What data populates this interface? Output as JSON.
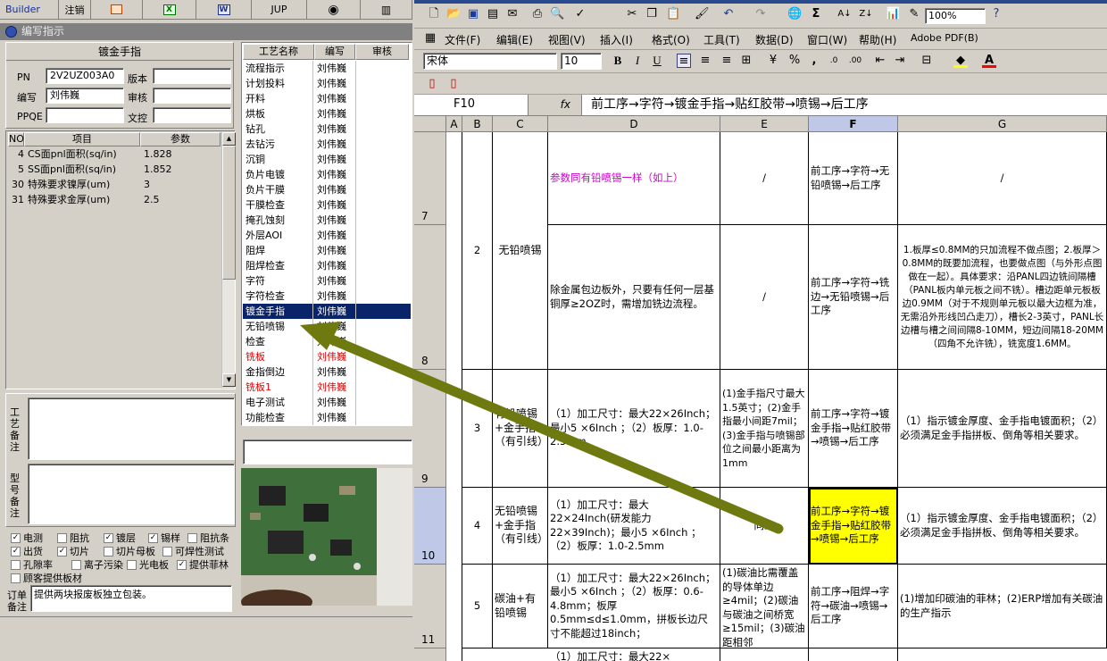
{
  "left_app": {
    "topbar": {
      "builder": "Builder",
      "logout": "注销",
      "jup": "JUP"
    },
    "dialog_title": "编写指示",
    "form": {
      "header": "镀金手指",
      "pn_label": "PN",
      "pn_value": "2V2UZ003A0",
      "version_label": "版本",
      "version_value": "",
      "writer_label": "编写",
      "writer_value": "刘伟巍",
      "review_label": "审核",
      "review_value": "",
      "ppqe_label": "PPQE",
      "ppqe_value": "",
      "doc_control_label": "文控",
      "doc_control_value": ""
    },
    "param_table": {
      "headers": [
        "NO",
        "项目",
        "参数"
      ],
      "rows": [
        {
          "no": "4",
          "item": "CS面pnl面积(sq/in)",
          "value": "1.828"
        },
        {
          "no": "5",
          "item": "SS面pnl面积(sq/in)",
          "value": "1.852"
        },
        {
          "no": "30",
          "item": "特殊要求镍厚(um)",
          "value": "3"
        },
        {
          "no": "31",
          "item": "特殊要求金厚(um)",
          "value": "2.5"
        }
      ]
    },
    "process_table": {
      "headers": [
        "工艺名称",
        "编写",
        "审核"
      ],
      "rows": [
        {
          "name": "流程指示",
          "writer": "刘伟巍",
          "red": false,
          "selected": false
        },
        {
          "name": "计划投料",
          "writer": "刘伟巍",
          "red": false,
          "selected": false
        },
        {
          "name": "开料",
          "writer": "刘伟巍",
          "red": false,
          "selected": false
        },
        {
          "name": "烘板",
          "writer": "刘伟巍",
          "red": false,
          "selected": false
        },
        {
          "name": "钻孔",
          "writer": "刘伟巍",
          "red": false,
          "selected": false
        },
        {
          "name": "去钻污",
          "writer": "刘伟巍",
          "red": false,
          "selected": false
        },
        {
          "name": "沉铜",
          "writer": "刘伟巍",
          "red": false,
          "selected": false
        },
        {
          "name": "负片电镀",
          "writer": "刘伟巍",
          "red": false,
          "selected": false
        },
        {
          "name": "负片干膜",
          "writer": "刘伟巍",
          "red": false,
          "selected": false
        },
        {
          "name": "干膜检查",
          "writer": "刘伟巍",
          "red": false,
          "selected": false
        },
        {
          "name": "掩孔蚀刻",
          "writer": "刘伟巍",
          "red": false,
          "selected": false
        },
        {
          "name": "外层AOI",
          "writer": "刘伟巍",
          "red": false,
          "selected": false
        },
        {
          "name": "阻焊",
          "writer": "刘伟巍",
          "red": false,
          "selected": false
        },
        {
          "name": "阻焊检查",
          "writer": "刘伟巍",
          "red": false,
          "selected": false
        },
        {
          "name": "字符",
          "writer": "刘伟巍",
          "red": false,
          "selected": false
        },
        {
          "name": "字符检查",
          "writer": "刘伟巍",
          "red": false,
          "selected": false
        },
        {
          "name": "镀金手指",
          "writer": "刘伟巍",
          "red": false,
          "selected": true
        },
        {
          "name": "无铅喷锡",
          "writer": "刘伟巍",
          "red": false,
          "selected": false
        },
        {
          "name": "检查",
          "writer": "刘伟巍",
          "red": false,
          "selected": false
        },
        {
          "name": "铣板",
          "writer": "刘伟巍",
          "red": true,
          "selected": false
        },
        {
          "name": "金指倒边",
          "writer": "刘伟巍",
          "red": false,
          "selected": false
        },
        {
          "name": "铣板1",
          "writer": "刘伟巍",
          "red": true,
          "selected": false
        },
        {
          "name": "电子测试",
          "writer": "刘伟巍",
          "red": false,
          "selected": false
        },
        {
          "name": "功能检查",
          "writer": "刘伟巍",
          "red": false,
          "selected": false
        }
      ]
    },
    "process_note_label": "工艺备注",
    "model_note_label": "型号备注",
    "checkboxes": [
      {
        "label": "电测",
        "checked": true
      },
      {
        "label": "阻抗",
        "checked": false
      },
      {
        "label": "镀层",
        "checked": true
      },
      {
        "label": "锡样",
        "checked": true
      },
      {
        "label": "阻抗条",
        "checked": false
      },
      {
        "label": "出货",
        "checked": true
      },
      {
        "label": "切片",
        "checked": true
      },
      {
        "label": "切片母板",
        "checked": false
      },
      {
        "label": "可焊性测试",
        "checked": false
      },
      {
        "label": "孔隙率",
        "checked": false
      },
      {
        "label": "离子污染",
        "checked": false
      },
      {
        "label": "光电板",
        "checked": false
      },
      {
        "label": "提供菲林",
        "checked": true
      },
      {
        "label": "顾客提供板材",
        "checked": false
      }
    ],
    "order_note_label": "订单备注",
    "order_note_text": "提供两块报废板独立包装。"
  },
  "excel": {
    "font_name": "宋体",
    "font_size": "10",
    "zoom": "100%",
    "menus": [
      "文件(F)",
      "编辑(E)",
      "视图(V)",
      "插入(I)",
      "格式(O)",
      "工具(T)",
      "数据(D)",
      "窗口(W)",
      "帮助(H)",
      "Adobe PDF(B)"
    ],
    "name_box": "F10",
    "formula": "前工序→字符→镀金手指→贴红胶带→喷锡→后工序",
    "columns": [
      "A",
      "B",
      "C",
      "D",
      "E",
      "F",
      "G"
    ],
    "row_numbers": [
      "7",
      "8",
      "9",
      "10",
      "11"
    ],
    "cells": {
      "r7_b": "2",
      "c78": "无铅喷锡",
      "r7_d": "参数同有铅喷锡一样（如上）",
      "r7_e": "/",
      "r7_f": "前工序→字符→无铅喷锡→后工序",
      "r7_g": "/",
      "r8_d": "除金属包边板外，只要有任何一层基铜厚≥2OZ时，需增加铣边流程。",
      "r8_e": "/",
      "r8_f": "前工序→字符→铣边→无铅喷锡→后工序",
      "r8_g": "1.板厚≤0.8MM的只加流程不做点图；2.板厚＞0.8MM的既要加流程，也要做点图（与外形点图做在一起）。具体要求：沿PANL四边铣间隔槽（PANL板内单元板之间不铣）。槽边距单元板板边0.9MM（对于不规则单元板以最大边框为准，无需沿外形线凹凸走刀），槽长2-3英寸，PANL长边槽与槽之间间隔8-10MM，短边间隔18-20MM（四角不允许铣），铣宽度1.6MM。",
      "r9_b": "3",
      "r9_c": "有铅喷锡+金手指（有引线）",
      "r9_d": "（1）加工尺寸：最大22×26Inch；最小5 ×6Inch ；（2）板厚：1.0-2.5mm",
      "r9_e": "(1)金手指尺寸最大1.5英寸；(2)金手指最小间距7mil；(3)金手指与喷锡部位之间最小距离为1mm",
      "r9_f": "前工序→字符→镀金手指→贴红胶带→喷锡→后工序",
      "r9_g": "（1）指示镀金厚度、金手指电镀面积；（2）必须满足金手指拼板、倒角等相关要求。",
      "r10_b": "4",
      "r10_c": "无铅喷锡+金手指（有引线）",
      "r10_d": "（1）加工尺寸：最大22×24Inch(研发能力22×39Inch)；最小5 ×6Inch ；（2）板厚：1.0-2.5mm",
      "r10_e": "同上",
      "r10_f": "前工序→字符→镀金手指→贴红胶带→喷锡→后工序",
      "r10_g": "（1）指示镀金厚度、金手指电镀面积；（2）必须满足金手指拼板、倒角等相关要求。",
      "r11_b": "5",
      "r11_c": "碳油+有铅喷锡",
      "r11_d": "（1）加工尺寸：最大22×26Inch；最小5 ×6Inch ；（2）板厚：0.6-4.8mm；板厚0.5mm≤d≤1.0mm，拼板长边尺寸不能超过18inch；",
      "r11_e": "(1)碳油比需覆盖的导体单边≥4mil；(2)碳油与碳油之间桥宽≥15mil；(3)碳油距相邻",
      "r11_f": "前工序→阻焊→字符→碳油→喷锡→后工序",
      "r11_g": "(1)增加印碳油的菲林；(2)ERP增加有关碳油的生产指示",
      "r12_d": "（1）加工尺寸：最大22×"
    },
    "colors": {
      "highlight": "#ffff00",
      "magenta_text": "#cc00cc",
      "arrow": "#6e7a10"
    }
  }
}
